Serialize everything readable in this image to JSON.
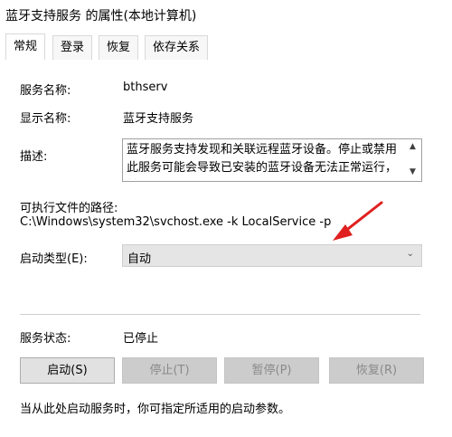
{
  "window": {
    "title": "蓝牙支持服务 的属性(本地计算机)"
  },
  "tabs": [
    {
      "label": "常规"
    },
    {
      "label": "登录"
    },
    {
      "label": "恢复"
    },
    {
      "label": "依存关系"
    }
  ],
  "general": {
    "service_name_label": "服务名称:",
    "service_name_value": "bthserv",
    "display_name_label": "显示名称:",
    "display_name_value": "蓝牙支持服务",
    "description_label": "描述:",
    "description_value": "蓝牙服务支持发现和关联远程蓝牙设备。停止或禁用此服务可能会导致已安装的蓝牙设备无法正常运行，并使",
    "exe_path_label": "可执行文件的路径:",
    "exe_path_value": "C:\\Windows\\system32\\svchost.exe -k LocalService -p",
    "startup_type_label": "启动类型(E):",
    "startup_type_value": "自动",
    "service_status_label": "服务状态:",
    "service_status_value": "已停止",
    "hint_text": "当从此处启动服务时，你可指定所适用的启动参数。"
  },
  "buttons": {
    "start": "启动(S)",
    "stop": "停止(T)",
    "pause": "暂停(P)",
    "resume": "恢复(R)"
  },
  "icons": {
    "scroll_up": "▲",
    "scroll_down": "▼",
    "dropdown": "⌄"
  },
  "colors": {
    "annotation_arrow": "#e02020"
  }
}
